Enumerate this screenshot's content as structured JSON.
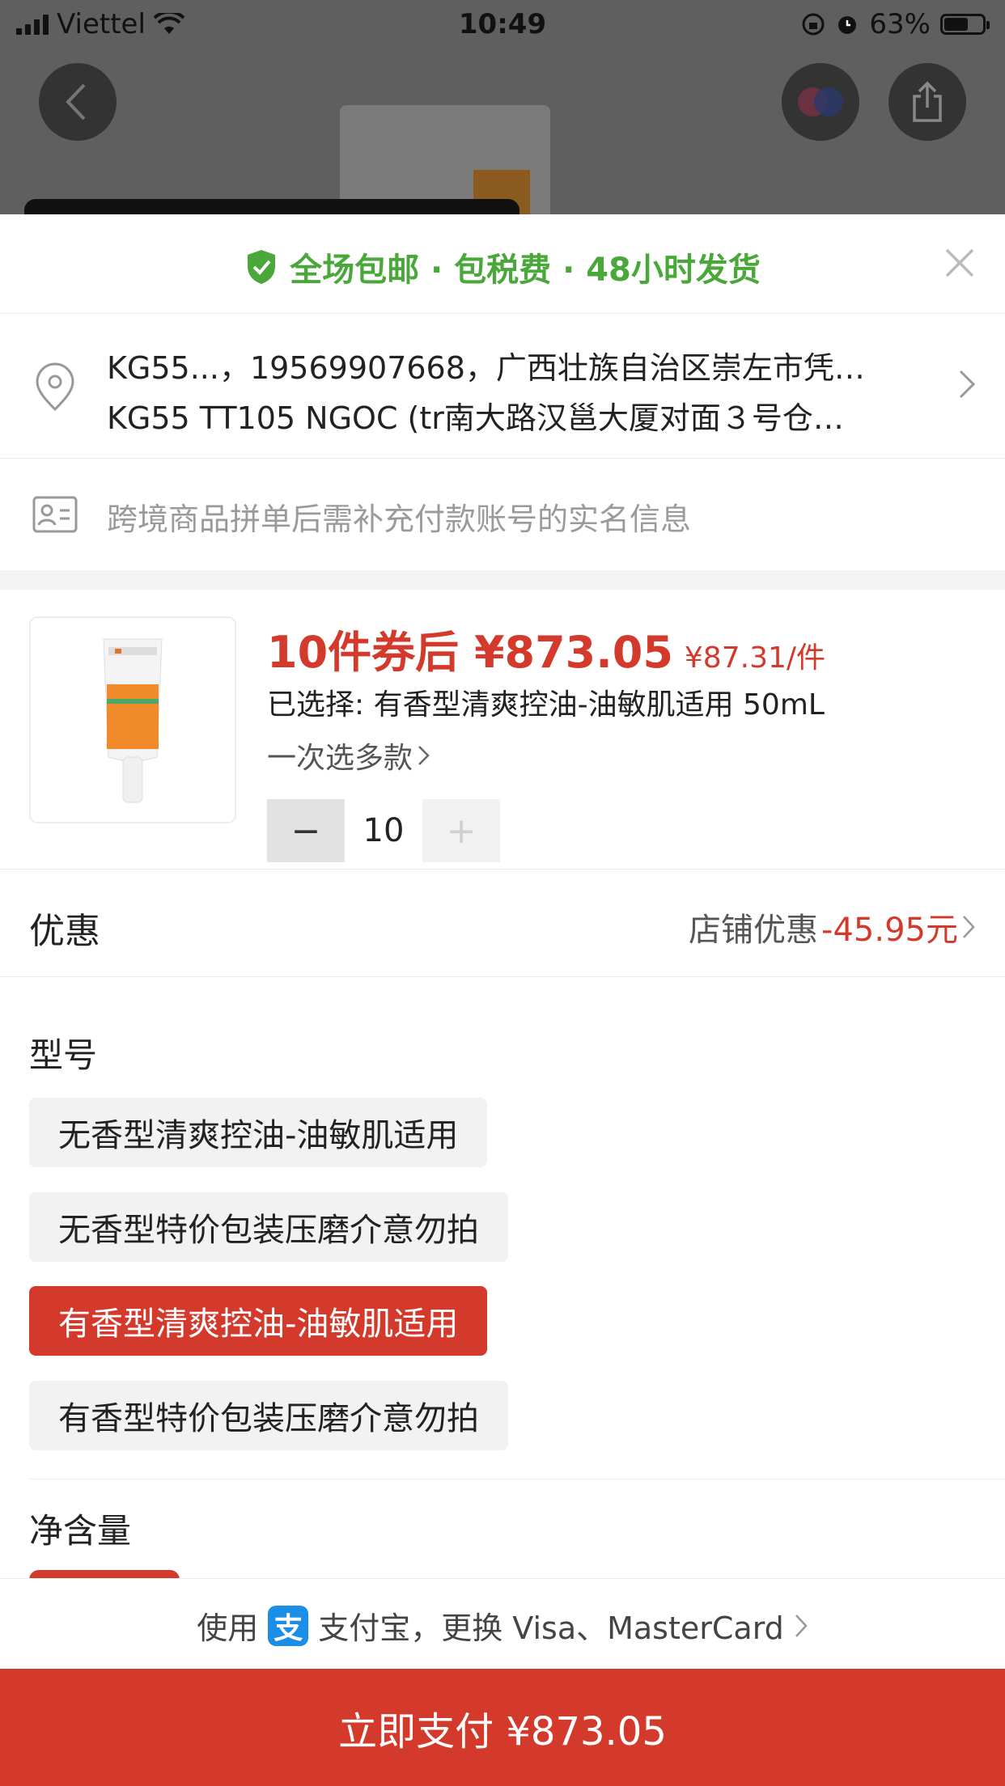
{
  "status_bar": {
    "carrier": "Viettel",
    "time": "10:49",
    "battery": "63%"
  },
  "banner": {
    "message": "全场包邮 · 包税费 · 48小时发货"
  },
  "address": {
    "line1": "KG55...，19569907668，广西壮族自治区崇左市凭…",
    "line2": "KG55 TT105 NGOC (tr南大路汉邕大厦对面３号仓…"
  },
  "realname": {
    "text": "跨境商品拼单后需补充付款账号的实名信息"
  },
  "product": {
    "price_main": "10件券后 ¥873.05",
    "price_unit": "¥87.31/件",
    "selected": "已选择: 有香型清爽控油-油敏肌适用 50mL",
    "multi_select": "一次选多款",
    "quantity": "10",
    "minus": "−",
    "plus": "+"
  },
  "coupon": {
    "label": "优惠",
    "store_label": "店铺优惠",
    "amount": "-45.95元"
  },
  "spec": {
    "title": "型号",
    "options": [
      "无香型清爽控油-油敏肌适用",
      "无香型特价包装压磨介意勿拍",
      "有香型清爽控油-油敏肌适用",
      "有香型特价包装压磨介意勿拍"
    ],
    "selected_index": 2
  },
  "volume": {
    "title": "净含量"
  },
  "payment": {
    "prefix": "使用",
    "alipay_glyph": "支",
    "method": "支付宝，更换 Visa、MasterCard"
  },
  "pay_button": {
    "label": "立即支付 ¥873.05"
  },
  "colors": {
    "accent": "#d33a2c",
    "green": "#4aa83a",
    "alipay": "#1b8fe8"
  }
}
